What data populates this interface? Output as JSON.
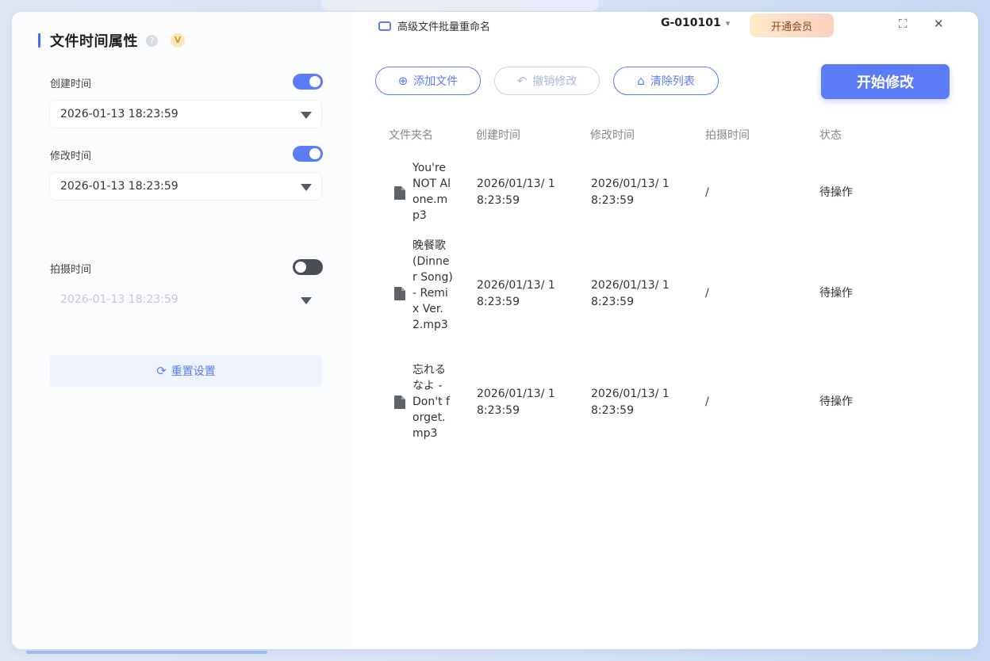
{
  "left_panel": {
    "title": "文件时间属性",
    "help_icon": "?",
    "vip_icon": "V",
    "created": {
      "label": "创建时间",
      "enabled": true,
      "value": "2026-01-13 18:23:59"
    },
    "modified": {
      "label": "修改时间",
      "enabled": true,
      "value": "2026-01-13 18:23:59"
    },
    "shot": {
      "label": "拍摄时间",
      "enabled": false,
      "value": "2026-01-13 18:23:59"
    },
    "reset_label": "重置设置"
  },
  "topbar": {
    "app_title": "高级文件批量重命名",
    "user_id": "G-010101",
    "vip_button": "开通会员",
    "maximize_icon": "⛶",
    "close_icon": "✕"
  },
  "toolbar": {
    "add_files": "添加文件",
    "undo_changes": "撤销修改",
    "clear_list": "清除列表",
    "start": "开始修改"
  },
  "table": {
    "headers": [
      "文件夹名",
      "创建时间",
      "修改时间",
      "拍摄时间",
      "状态"
    ],
    "rows": [
      {
        "name": "You're NOT Alone.mp3",
        "created": "2026/01/13/ 18:23:59",
        "modified": "2026/01/13/ 18:23:59",
        "shot": "/",
        "status": "待操作"
      },
      {
        "name": "晚餐歌 (Dinner Song) - Remix Ver. 2.mp3",
        "created": "2026/01/13/ 18:23:59",
        "modified": "2026/01/13/ 18:23:59",
        "shot": "/",
        "status": "待操作"
      },
      {
        "name": "忘れるなよ - Don't forget.mp3",
        "created": "2026/01/13/ 18:23:59",
        "modified": "2026/01/13/ 18:23:59",
        "shot": "/",
        "status": "待操作"
      }
    ]
  },
  "colors": {
    "accent": "#5b7cf6",
    "toggle_off": "#4a4d56",
    "reset_bg": "#eef3fd"
  }
}
